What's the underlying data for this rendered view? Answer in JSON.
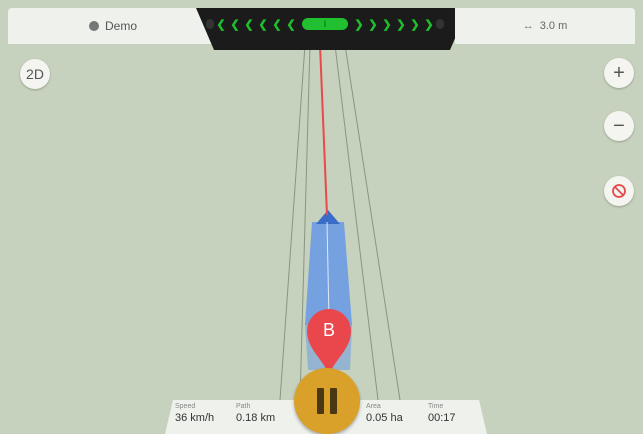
{
  "topbar": {
    "left_label": "Demo",
    "right_label": "3.0 m",
    "left_icon": "globe-icon",
    "right_icon": "width-arrows-icon",
    "lightbar": {
      "left_chevrons": [
        "❮",
        "❮",
        "❮",
        "❮",
        "❮",
        "❮"
      ],
      "right_chevrons": [
        "❯",
        "❯",
        "❯",
        "❯",
        "❯",
        "❯"
      ],
      "center_value": "I",
      "active_color": "#1fbf2b"
    }
  },
  "controls": {
    "view_toggle": "2D",
    "zoom_in": "+",
    "zoom_out": "−",
    "auto_icon": "no-autosteer-icon"
  },
  "marker": {
    "label": "B",
    "color": "#e9474b"
  },
  "stats": {
    "speed": {
      "label": "Speed",
      "value": "36 km/h"
    },
    "path": {
      "label": "Path",
      "value": "0.18 km"
    },
    "area": {
      "label": "Area",
      "value": "0.05 ha"
    },
    "time": {
      "label": "Time",
      "value": "00:17"
    }
  },
  "pause_icon": "pause-icon",
  "colors": {
    "map_bg": "#c6d2bd",
    "coverage": "#6d9be3",
    "guideline": "#e64a4a",
    "pause_button": "#d9a02a"
  }
}
